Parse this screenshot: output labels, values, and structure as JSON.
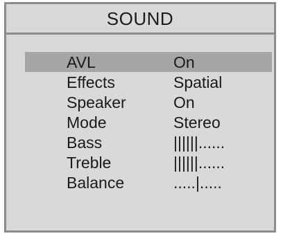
{
  "menu": {
    "title": "SOUND",
    "items": [
      {
        "label": "AVL",
        "value": "On",
        "selected": true
      },
      {
        "label": "Effects",
        "value": "Spatial"
      },
      {
        "label": "Speaker",
        "value": "On"
      },
      {
        "label": "Mode",
        "value": "Stereo"
      },
      {
        "label": "Bass",
        "value": "||||||......"
      },
      {
        "label": "Treble",
        "value": "||||||......"
      },
      {
        "label": "Balance",
        "value": ".....|....."
      }
    ]
  },
  "colors": {
    "background": "#d9d9d9",
    "border": "#8c8c8c",
    "selected_row": "#a6a6a6",
    "text": "#1a1a1a"
  }
}
